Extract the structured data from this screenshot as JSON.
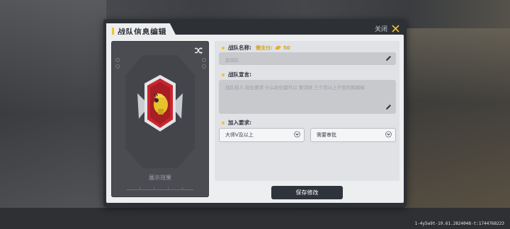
{
  "dialog": {
    "title": "战队信息编辑",
    "close_label": "关闭"
  },
  "preview": {
    "label": "展示效果"
  },
  "form": {
    "name": {
      "label": "战队名称:",
      "cost_label": "需支付:",
      "cost_value": "50",
      "placeholder": "加战队"
    },
    "declaration": {
      "label": "战队宣言:",
      "placeholder": "战队招人 段位要求 什么段位都可以 要活跃 三个月以上不登的就踢掉"
    },
    "requirements": {
      "label": "加入要求:",
      "rank_selected": "大师V及以上",
      "approval_selected": "需要审批"
    }
  },
  "save_label": "保存修改",
  "footer_id": "1-4y5w9t-19.61.2824048-t:1744768223",
  "colors": {
    "accent": "#f2c12e",
    "panel_dark": "#2d3035",
    "emblem_red": "#c8262e",
    "emblem_gold": "#e6c22c"
  }
}
